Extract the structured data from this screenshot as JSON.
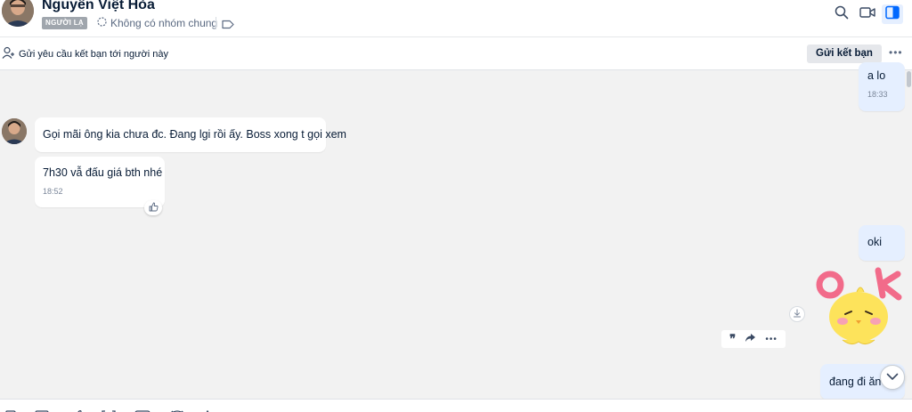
{
  "header": {
    "contact_name": "Nguyễn Việt Hòa",
    "stranger_badge": "NGƯỜI LẠ",
    "group_info": "Không có nhóm chung"
  },
  "friend_bar": {
    "text": "Gửi yêu cầu kết bạn tới người này",
    "send_button": "Gửi kết bạn"
  },
  "messages": [
    {
      "side": "out",
      "text": "a lo",
      "time": "18:33"
    },
    {
      "side": "in",
      "text": "Gọi mãi ông kia chưa đc. Đang lgi rồi ấy. Boss xong t gọi xem"
    },
    {
      "side": "in",
      "text": "7h30 vẫ đấu giá bth nhé",
      "time": "18:52"
    },
    {
      "side": "out",
      "text": "oki"
    },
    {
      "side": "out",
      "sticker": "ok-chick-sticker"
    },
    {
      "side": "out",
      "text": "đang đi ăn r"
    }
  ],
  "colors": {
    "accent": "#0068ff",
    "outgoing_bubble": "#e5efff",
    "incoming_bubble": "#ffffff",
    "chat_background": "#f2f2f2",
    "sticker_pink": "#f26b8a",
    "sticker_yellow": "#fde35b"
  },
  "icons": {
    "header": [
      "search-icon",
      "video-call-icon",
      "sidebar-toggle-icon"
    ],
    "toolbar": [
      "sticker-icon",
      "image-icon",
      "attach-icon",
      "screenshot-icon",
      "card-icon",
      "reminder-icon",
      "format-text-icon"
    ]
  }
}
